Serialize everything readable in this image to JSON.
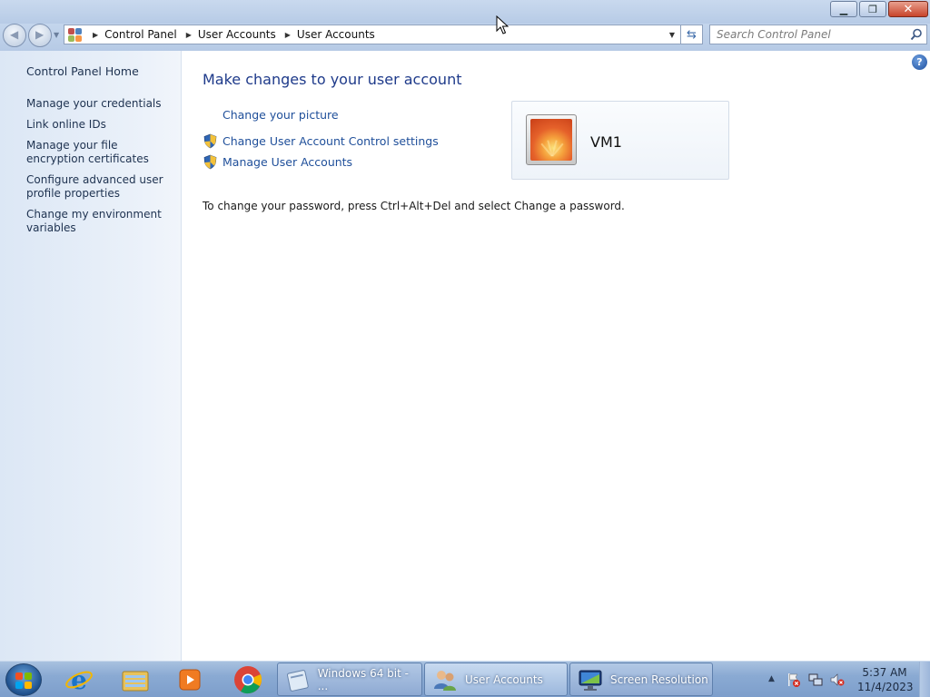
{
  "window": {
    "minimize_glyph": "▁",
    "restore_glyph": "❐",
    "close_glyph": "✕"
  },
  "nav": {
    "back_glyph": "◀",
    "forward_glyph": "▶",
    "breadcrumb": [
      "Control Panel",
      "User Accounts",
      "User Accounts"
    ],
    "search_placeholder": "Search Control Panel"
  },
  "sidebar": {
    "home": "Control Panel Home",
    "links": [
      "Manage your credentials",
      "Link online IDs",
      "Manage your file encryption certificates",
      "Configure advanced user profile properties",
      "Change my environment variables"
    ]
  },
  "main": {
    "heading": "Make changes to your user account",
    "tasks": [
      {
        "label": "Change your picture",
        "shield": false
      },
      {
        "label": "Change User Account Control settings",
        "shield": true
      },
      {
        "label": "Manage User Accounts",
        "shield": true
      }
    ],
    "account_name": "VM1",
    "password_note": "To change your password, press Ctrl+Alt+Del and select Change a password.",
    "help_glyph": "?"
  },
  "taskbar": {
    "buttons": [
      {
        "label": "Windows 64 bit - ...",
        "icon": "document-icon"
      },
      {
        "label": "User Accounts",
        "icon": "users-icon"
      },
      {
        "label": "Screen Resolution",
        "icon": "monitor-icon"
      }
    ],
    "clock_time": "5:37 AM",
    "clock_date": "11/4/2023"
  },
  "colors": {
    "link": "#1f4f9a",
    "heading": "#1e3a8a",
    "sidebar_bg": "#e3ecf7",
    "taskbar": "#8aaad3"
  }
}
